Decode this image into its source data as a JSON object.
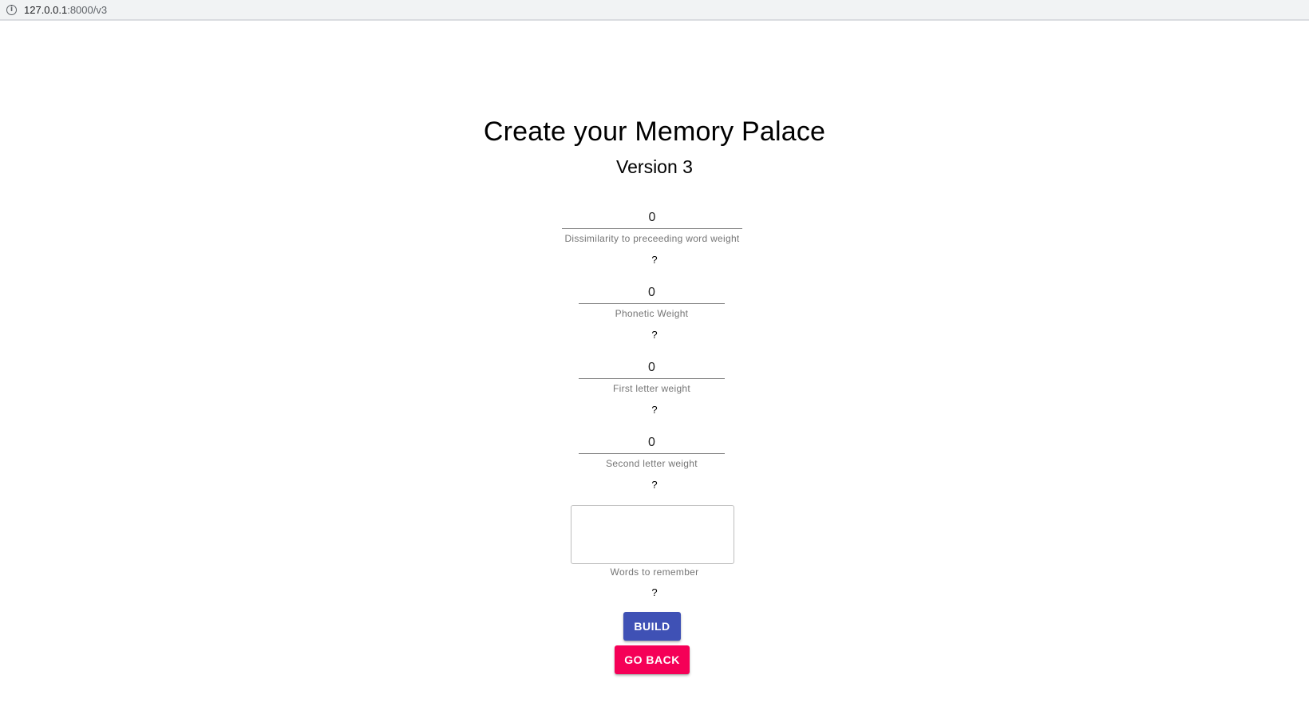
{
  "browser": {
    "url_host": "127.0.0.1",
    "url_rest": ":8000/v3",
    "info_icon": "info-icon"
  },
  "page": {
    "title": "Create your Memory Palace",
    "subtitle": "Version 3"
  },
  "fields": [
    {
      "value": "0",
      "label": "Dissimilarity to preceeding word weight",
      "help": "?"
    },
    {
      "value": "0",
      "label": "Phonetic Weight",
      "help": "?"
    },
    {
      "value": "0",
      "label": "First letter weight",
      "help": "?"
    },
    {
      "value": "0",
      "label": "Second letter weight",
      "help": "?"
    }
  ],
  "words": {
    "value": "",
    "label": "Words to remember",
    "help": "?"
  },
  "buttons": {
    "build_label": "BUILD",
    "back_label": "GO BACK"
  },
  "colors": {
    "primary": "#3f51b5",
    "secondary": "#f50057"
  }
}
